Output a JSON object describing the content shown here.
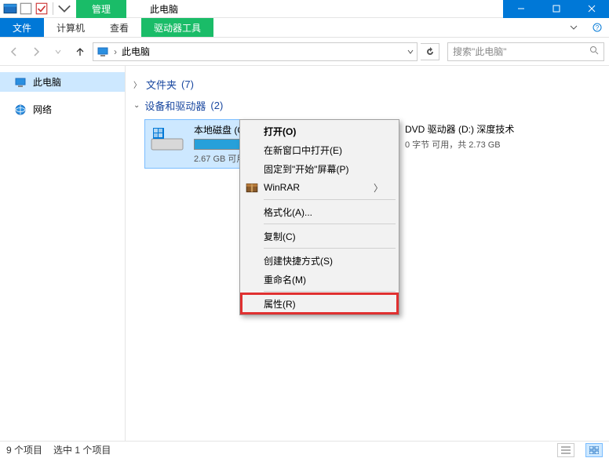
{
  "titlebar": {
    "context_tab": "管理",
    "title": "此电脑"
  },
  "ribbon": {
    "file": "文件",
    "computer": "计算机",
    "view": "查看",
    "drive_tools": "驱动器工具"
  },
  "nav": {
    "location": "此电脑",
    "search_placeholder": "搜索\"此电脑\""
  },
  "sidebar": {
    "this_pc": "此电脑",
    "network": "网络"
  },
  "groups": {
    "folders": {
      "label": "文件夹",
      "count": "(7)"
    },
    "devices": {
      "label": "设备和驱动器",
      "count": "(2)"
    }
  },
  "drives": [
    {
      "name": "本地磁盘 (C:)",
      "size_text": "2.67 GB 可用",
      "fill_percent": 92,
      "selected": true
    },
    {
      "name": "DVD 驱动器 (D:) 深度技术",
      "size_text": "0 字节 可用，共 2.73 GB",
      "fill_percent": 0,
      "selected": false
    }
  ],
  "context_menu": {
    "open": "打开(O)",
    "open_new_window": "在新窗口中打开(E)",
    "pin_to_start": "固定到\"开始\"屏幕(P)",
    "winrar": "WinRAR",
    "format": "格式化(A)...",
    "copy": "复制(C)",
    "create_shortcut": "创建快捷方式(S)",
    "rename": "重命名(M)",
    "properties": "属性(R)"
  },
  "status": {
    "items": "9 个项目",
    "selected": "选中 1 个项目"
  }
}
